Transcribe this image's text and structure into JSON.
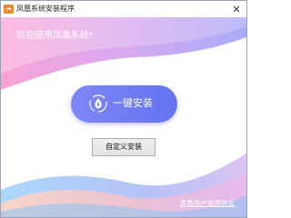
{
  "window": {
    "title": "凤凰系统安装程序",
    "close_glyph": "✕"
  },
  "welcome_text": "欢迎使用凤凰系统!",
  "install_button": {
    "label": "一键安装",
    "icon": "phoenix-logo-icon"
  },
  "custom_install_button": {
    "label": "自定义安装"
  },
  "agreement_link": {
    "label": "查看用户使用协议"
  },
  "colors": {
    "accent": "#6d7af4",
    "header_gradient_start": "#f7a6d9",
    "header_gradient_end": "#b9a6f8",
    "footer_blue": "#7bb7f5",
    "footer_peach": "#fbc7b0"
  }
}
